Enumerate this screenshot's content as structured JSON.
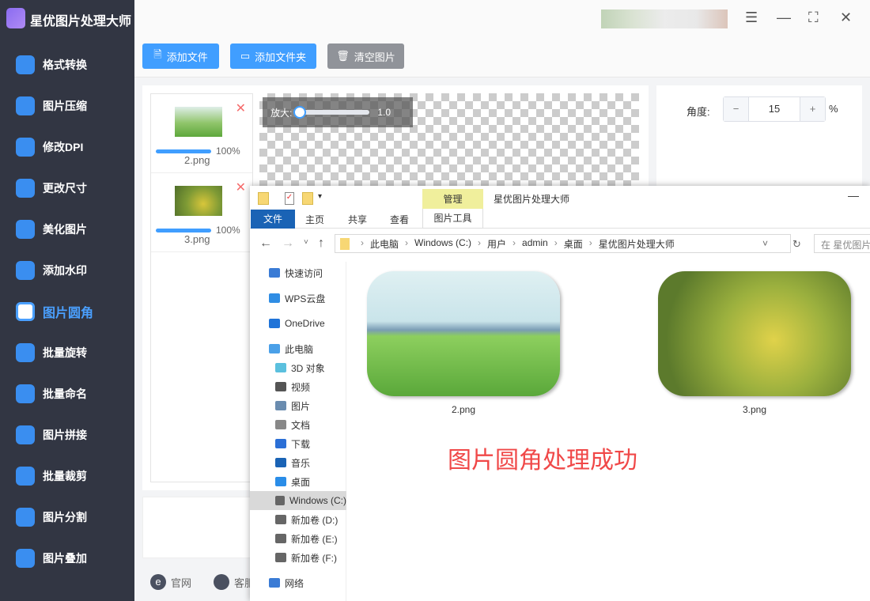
{
  "app": {
    "title": "星优图片处理大师"
  },
  "sidebar": {
    "items": [
      {
        "label": "格式转换"
      },
      {
        "label": "图片压缩"
      },
      {
        "label": "修改DPI"
      },
      {
        "label": "更改尺寸"
      },
      {
        "label": "美化图片"
      },
      {
        "label": "添加水印"
      },
      {
        "label": "图片圆角",
        "active": true
      },
      {
        "label": "批量旋转"
      },
      {
        "label": "批量命名"
      },
      {
        "label": "图片拼接"
      },
      {
        "label": "批量裁剪"
      },
      {
        "label": "图片分割"
      },
      {
        "label": "图片叠加"
      }
    ]
  },
  "toolbar": {
    "add_file": "添加文件",
    "add_folder": "添加文件夹",
    "clear": "清空图片"
  },
  "files": [
    {
      "name": "2.png",
      "progress": "100%",
      "progress_value": 100
    },
    {
      "name": "3.png",
      "progress": "100%",
      "progress_value": 100
    }
  ],
  "preview": {
    "zoom_label": "放大:",
    "zoom_value": "1.0"
  },
  "settings": {
    "angle_label": "角度:",
    "angle_value": "15",
    "unit": "%",
    "minus": "−",
    "plus": "+"
  },
  "footer": {
    "website": "官网",
    "support": "客服"
  },
  "explorer": {
    "title": "星优图片处理大师",
    "context_tab": "管理",
    "ribbon_tabs": [
      "文件",
      "主页",
      "共享",
      "查看",
      "图片工具"
    ],
    "path": [
      "此电脑",
      "Windows (C:)",
      "用户",
      "admin",
      "桌面",
      "星优图片处理大师"
    ],
    "search_placeholder": "在 星优图片",
    "tree": [
      "快速访问",
      "WPS云盘",
      "OneDrive",
      "此电脑",
      "3D 对象",
      "视频",
      "图片",
      "文档",
      "下载",
      "音乐",
      "桌面",
      "Windows (C:)",
      "新加卷 (D:)",
      "新加卷 (E:)",
      "新加卷 (F:)",
      "网络"
    ],
    "files": [
      {
        "name": "2.png"
      },
      {
        "name": "3.png"
      }
    ],
    "overlay_message": "图片圆角处理成功"
  }
}
